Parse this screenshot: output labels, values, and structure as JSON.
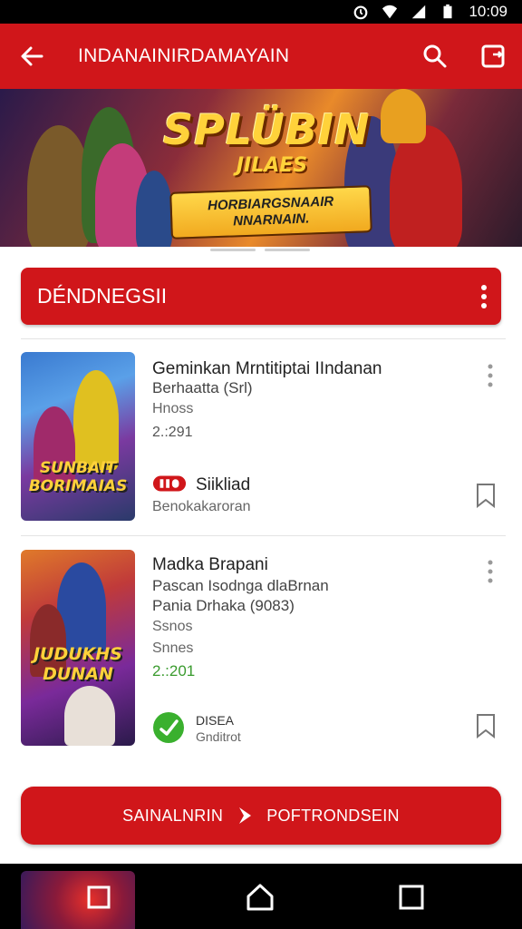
{
  "status_bar": {
    "time": "10:09"
  },
  "app_bar": {
    "title": "INDANAINIRDAMAYAIN"
  },
  "banner": {
    "title": "SPLÜBIN",
    "title_line2": "JILAES",
    "subtitle": "HORBIARGSNAAIR NNARNAIN."
  },
  "section": {
    "title": "DÉNDNEGSII"
  },
  "items": [
    {
      "thumb_label": "SUNBAIT BORIMAIAS",
      "title": "Geminkan Mrntitiptai IIndanan",
      "line1": "Berhaatta (Srl)",
      "line2": "Hnoss",
      "value": "2.:291",
      "badge_text": "Siikliad",
      "tag": "Benokakaroran"
    },
    {
      "thumb_label": "JUDUKHS DUNAN",
      "title": "Madka Brapani",
      "line1": "Pascan Isodnga dlaBrnan",
      "line2": "Pania Drhaka (9083)",
      "line3": "Ssnos",
      "line4": "Snnes",
      "value": "2.:201",
      "badge_text": "DISEA",
      "tag": "Gnditrot"
    }
  ],
  "bottom_button": {
    "label_left": "SAINALNRIN",
    "label_right": "POFTRONDSEIN"
  },
  "colors": {
    "primary": "#d0161a",
    "accent_green": "#3a9b2e"
  }
}
